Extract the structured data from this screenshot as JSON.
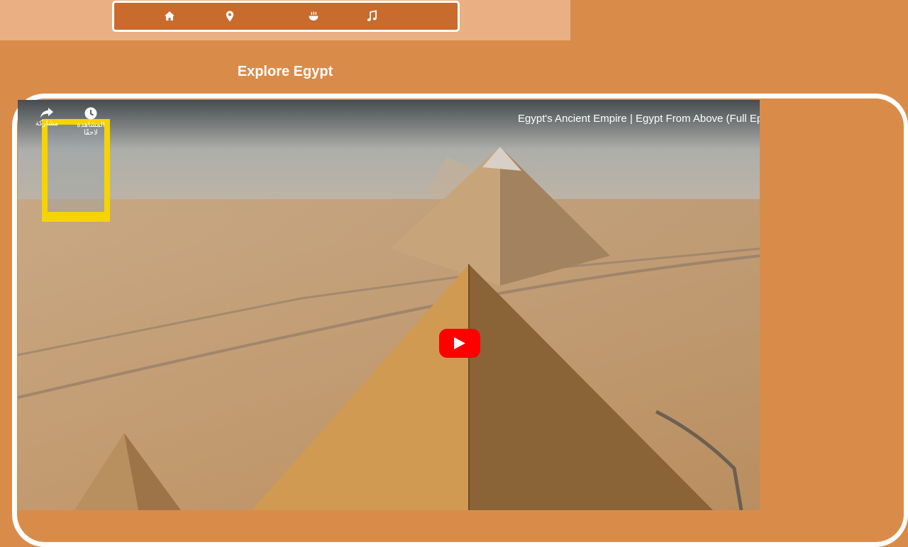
{
  "nav": {
    "items": [
      {
        "icon": "home-icon"
      },
      {
        "icon": "map-pin-icon"
      },
      {
        "icon": "food-bowl-icon"
      },
      {
        "icon": "music-note-icon"
      }
    ]
  },
  "page": {
    "title": "Explore Egypt"
  },
  "video": {
    "title": "Egypt's Ancient Empire | Egypt From Above (Full Ep",
    "share_label": "مشاركة",
    "watch_later_label": "المشاهدة لاحقًا",
    "play_icon": "youtube-play-icon",
    "channel_logo": "national-geographic-logo"
  },
  "colors": {
    "background": "#d98c4a",
    "top_band": "#eab083",
    "nav_bar": "#c96b2c",
    "play_button": "#ff0000",
    "logo_yellow": "#f5d400"
  }
}
